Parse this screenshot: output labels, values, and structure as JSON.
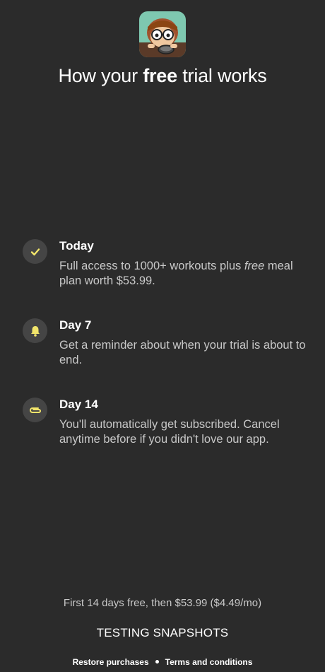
{
  "header": {
    "title_before": "How your ",
    "title_bold": "free",
    "title_after": " trial works"
  },
  "steps": [
    {
      "heading": "Today",
      "desc_before": "Full access to 1000+ workouts plus ",
      "desc_italic": "free",
      "desc_after": " meal plan worth $53.99.",
      "icon": "checkmark-icon"
    },
    {
      "heading": "Day 7",
      "desc": "Get a reminder about when your trial is about to end.",
      "icon": "bell-icon"
    },
    {
      "heading": "Day 14",
      "desc": "You'll automatically get subscribed. Cancel anytime before if you didn't love our app.",
      "icon": "paperclip-icon"
    }
  ],
  "pricing_text": "First 14 days free, then $53.99 ($4.49/mo)",
  "cta_label": "TESTING SNAPSHOTS",
  "footer": {
    "restore_label": "Restore purchases",
    "terms_label": "Terms and conditions"
  },
  "colors": {
    "background": "#2b2b2b",
    "badge": "#454545",
    "accent_yellow": "#f2e56b",
    "muted_text": "#c8c8c8"
  }
}
